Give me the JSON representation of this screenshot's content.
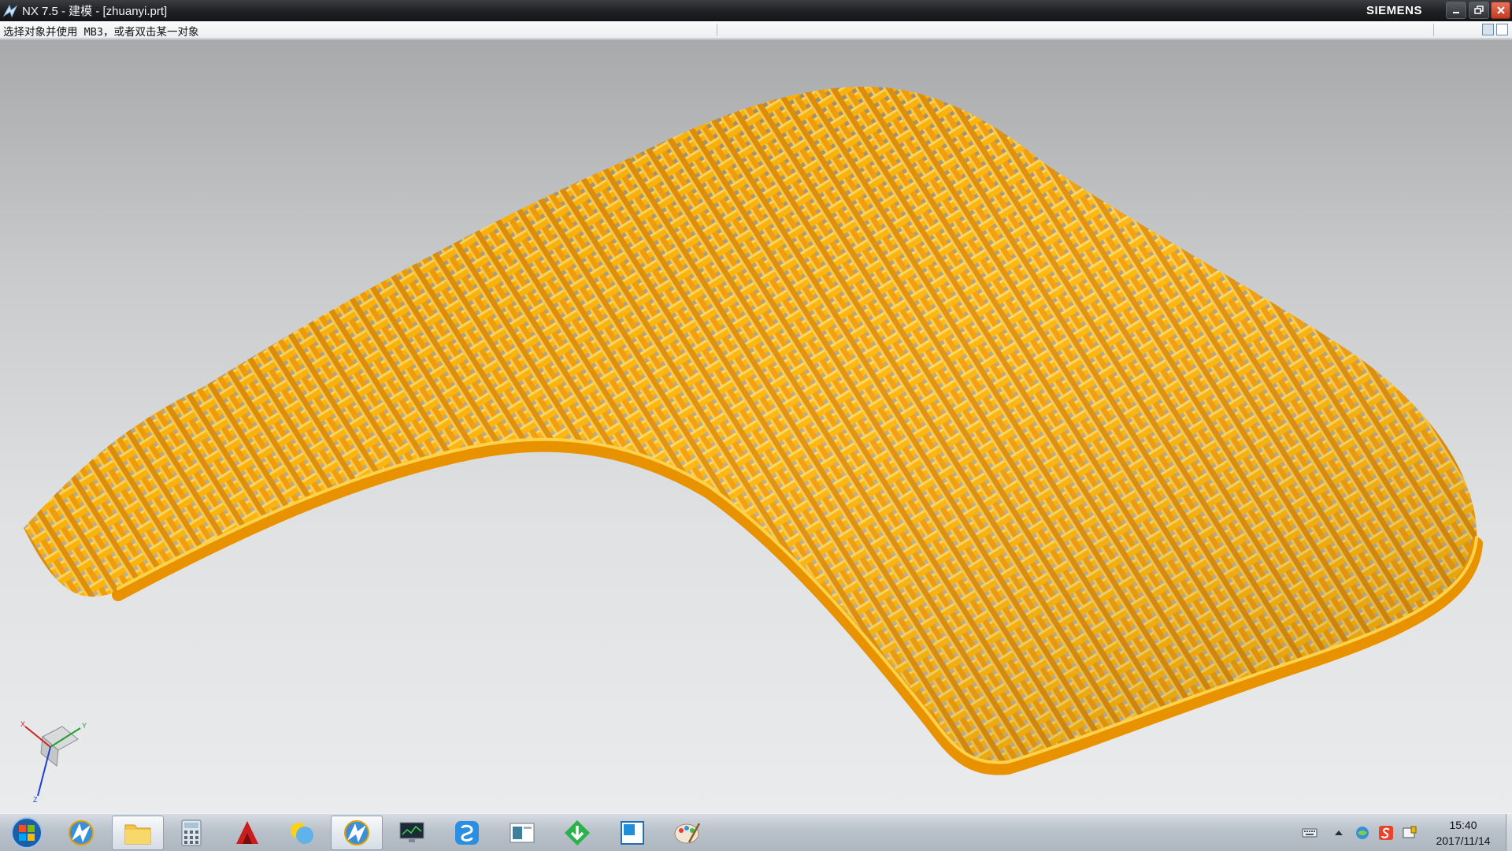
{
  "window": {
    "title": "NX 7.5 - 建模 - [zhuanyi.prt]",
    "brand": "SIEMENS"
  },
  "cue_line": {
    "message": "选择对象并使用 MB3，或者双击某一对象"
  },
  "viewport": {
    "model": "woven-lattice-chair-shell",
    "model_color": "#f5a300",
    "triad_axes": [
      "X",
      "Y",
      "Z"
    ]
  },
  "taskbar": {
    "start": "start-orb",
    "apps": [
      {
        "name": "nx-app",
        "active": false
      },
      {
        "name": "file-explorer",
        "active": true
      },
      {
        "name": "calculator",
        "active": false
      },
      {
        "name": "autocad",
        "active": false
      },
      {
        "name": "messenger",
        "active": false
      },
      {
        "name": "nx-app-2",
        "active": true
      },
      {
        "name": "monitor",
        "active": false
      },
      {
        "name": "qq-browser",
        "active": false
      },
      {
        "name": "viewer",
        "active": false
      },
      {
        "name": "downloader",
        "active": false
      },
      {
        "name": "window-app",
        "active": false
      },
      {
        "name": "paint",
        "active": false
      }
    ],
    "clock": {
      "time": "15:40",
      "date": "2017/11/14"
    }
  }
}
